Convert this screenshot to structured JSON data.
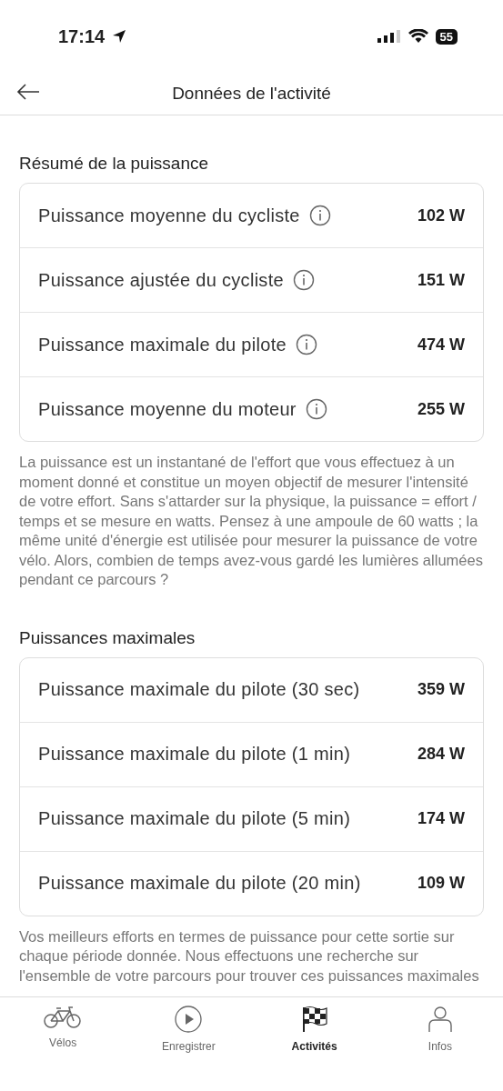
{
  "status_bar": {
    "time": "17:14",
    "battery": "55"
  },
  "header": {
    "title": "Données de l'activité"
  },
  "sections": [
    {
      "title": "Résumé de la puissance",
      "rows": [
        {
          "label": "Puissance moyenne du cycliste",
          "info": true,
          "value": "102 W"
        },
        {
          "label": "Puissance ajustée du cycliste",
          "info": true,
          "value": "151 W"
        },
        {
          "label": "Puissance maximale du pilote",
          "info": true,
          "value": "474 W"
        },
        {
          "label": "Puissance moyenne du moteur",
          "info": true,
          "value": "255 W"
        }
      ],
      "note": "La puissance est un instantané de l'effort que vous effectuez à un moment donné et constitue un moyen objectif de mesurer l'intensité de votre effort. Sans s'attarder sur la physique, la puissance = effort / temps et se mesure en watts. Pensez à une ampoule de 60 watts ; la même unité d'énergie est utilisée pour mesurer la puissance de votre vélo. Alors, combien de temps avez-vous gardé les lumières allumées pendant ce parcours ?"
    },
    {
      "title": "Puissances maximales",
      "rows": [
        {
          "label": "Puissance maximale du pilote (30 sec)",
          "info": false,
          "value": "359 W"
        },
        {
          "label": "Puissance maximale du pilote (1 min)",
          "info": false,
          "value": "284 W"
        },
        {
          "label": "Puissance maximale du pilote (5 min)",
          "info": false,
          "value": "174 W"
        },
        {
          "label": "Puissance maximale du pilote (20 min)",
          "info": false,
          "value": "109 W"
        }
      ],
      "note": "Vos meilleurs efforts en termes de puissance pour cette sortie sur chaque période donnée. Nous effectuons une recherche sur l'ensemble de votre parcours pour trouver ces puissances maximales"
    }
  ],
  "tab_bar": [
    {
      "kind": "bike",
      "label": "Vélos",
      "selected": false
    },
    {
      "kind": "play",
      "label": "Enregistrer",
      "selected": false
    },
    {
      "kind": "flag",
      "label": "Activités",
      "selected": true
    },
    {
      "kind": "person",
      "label": "Infos",
      "selected": false
    }
  ]
}
